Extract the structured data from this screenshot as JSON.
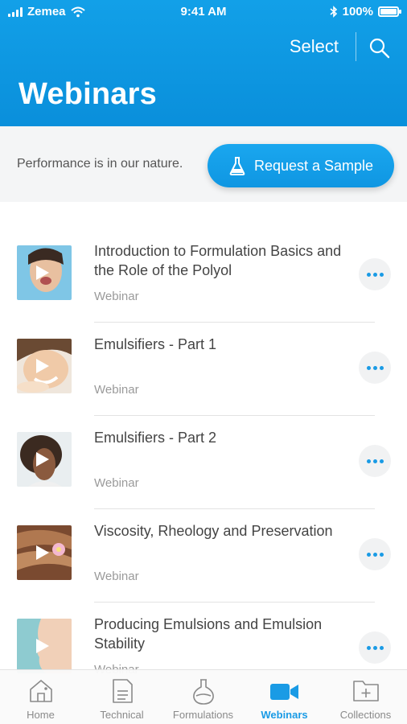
{
  "status_bar": {
    "carrier": "Zemea",
    "time": "9:41 AM",
    "battery": "100%",
    "battery_level": 1.0
  },
  "header": {
    "select_label": "Select",
    "title": "Webinars"
  },
  "promo": {
    "tagline": "Performance is in our nature.",
    "button_label": "Request a Sample"
  },
  "items": [
    {
      "title": "Introduction to Formulation Basics and the Role of the Polyol",
      "type": "Webinar",
      "thumb": "woman-face"
    },
    {
      "title": "Emulsifiers - Part 1",
      "type": "Webinar",
      "thumb": "smiling-face"
    },
    {
      "title": "Emulsifiers - Part 2",
      "type": "Webinar",
      "thumb": "curly-hair"
    },
    {
      "title": "Viscosity, Rheology and Preservation",
      "type": "Webinar",
      "thumb": "hair-flower"
    },
    {
      "title": "Producing Emulsions and Emulsion Stability",
      "type": "Webinar",
      "thumb": "face-profile"
    }
  ],
  "tabs": [
    {
      "label": "Home",
      "icon": "home-icon"
    },
    {
      "label": "Technical",
      "icon": "document-icon"
    },
    {
      "label": "Formulations",
      "icon": "flask-icon"
    },
    {
      "label": "Webinars",
      "icon": "video-icon",
      "active": true
    },
    {
      "label": "Collections",
      "icon": "folder-add-icon"
    }
  ],
  "colors": {
    "brand": "#0f96e2",
    "active_tab": "#1a9be5"
  }
}
